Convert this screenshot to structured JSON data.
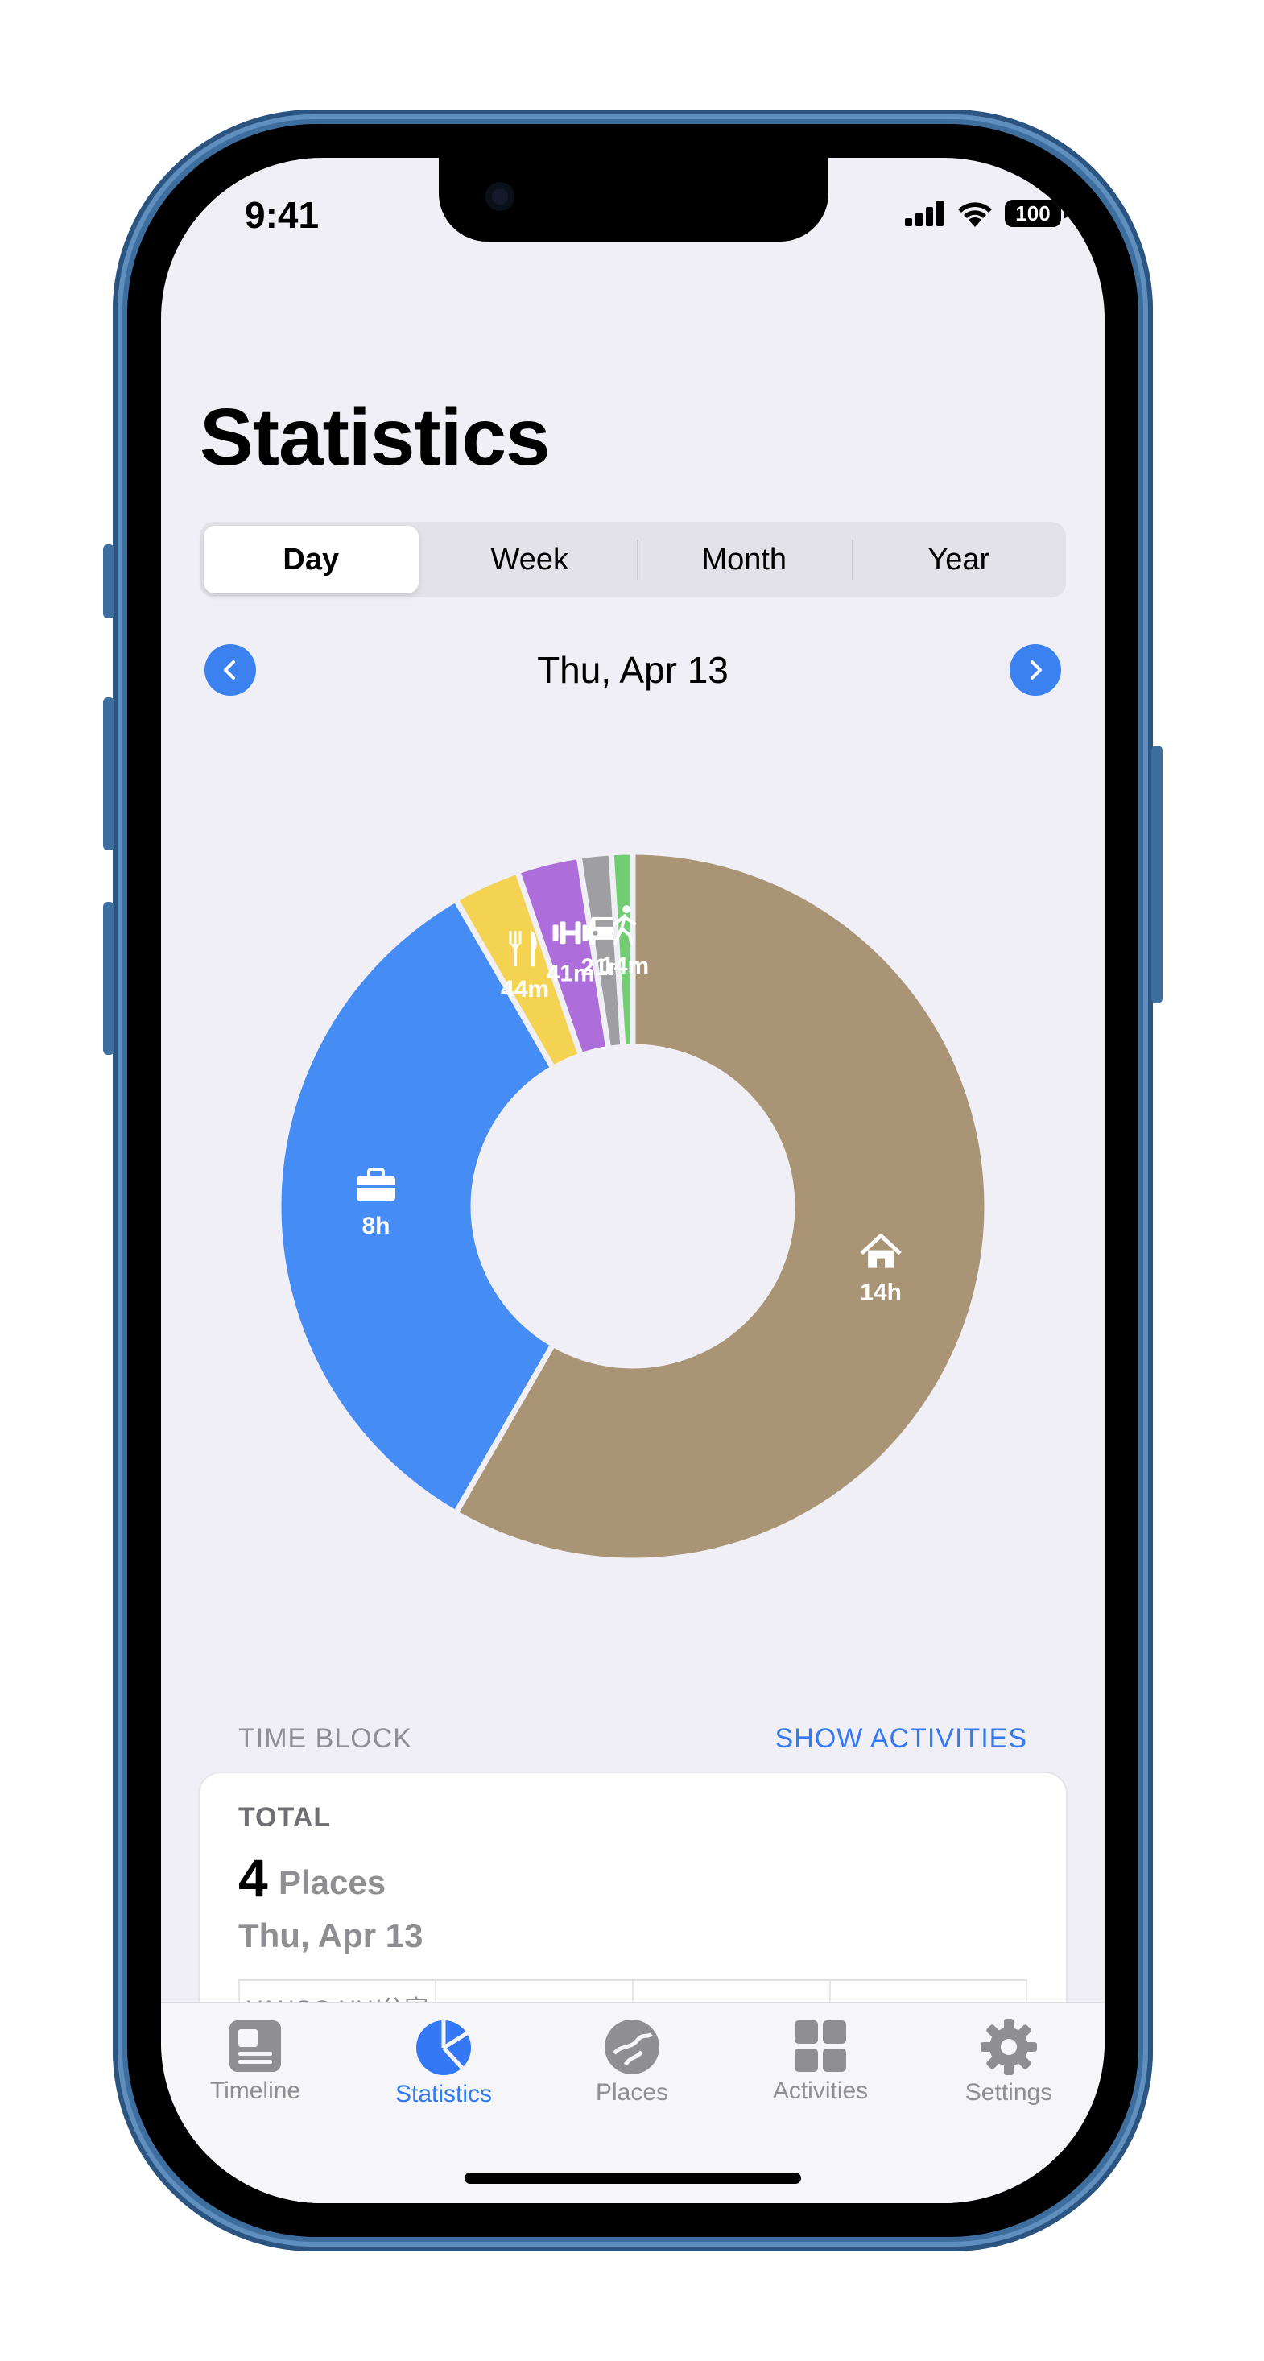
{
  "status": {
    "time": "9:41",
    "battery": "100"
  },
  "page": {
    "title": "Statistics"
  },
  "segments": [
    "Day",
    "Week",
    "Month",
    "Year"
  ],
  "date_nav": {
    "label": "Thu, Apr 13"
  },
  "chart_data": {
    "type": "pie",
    "slices": [
      {
        "label": "14h",
        "icon": "house-icon",
        "minutes": 840,
        "color": "#a99476"
      },
      {
        "label": "8h",
        "icon": "briefcase-icon",
        "minutes": 480,
        "color": "#458cf5"
      },
      {
        "label": "44m",
        "icon": "fork-knife-icon",
        "minutes": 44,
        "color": "#f5d352"
      },
      {
        "label": "41m",
        "icon": "dumbbell-icon",
        "minutes": 41,
        "color": "#ad6edc"
      },
      {
        "label": "21m",
        "icon": "car-icon",
        "minutes": 21,
        "color": "#9e9ea3"
      },
      {
        "label": "14m",
        "icon": "walking-icon",
        "minutes": 14,
        "color": "#72cc72"
      }
    ]
  },
  "time_block": {
    "section_title": "TIME BLOCK",
    "action": "SHOW ACTIVITIES",
    "total_label": "TOTAL",
    "count": "4",
    "unit": "Places",
    "date": "Thu, Apr 13",
    "grid_text": "YANGO HU/公寓"
  },
  "tabs": [
    {
      "label": "Timeline",
      "icon": "timeline-icon"
    },
    {
      "label": "Statistics",
      "icon": "statistics-icon"
    },
    {
      "label": "Places",
      "icon": "places-icon"
    },
    {
      "label": "Activities",
      "icon": "activities-icon"
    },
    {
      "label": "Settings",
      "icon": "gear-icon"
    }
  ],
  "colors": {
    "accent": "#3478f6",
    "background": "#f0eff5"
  }
}
